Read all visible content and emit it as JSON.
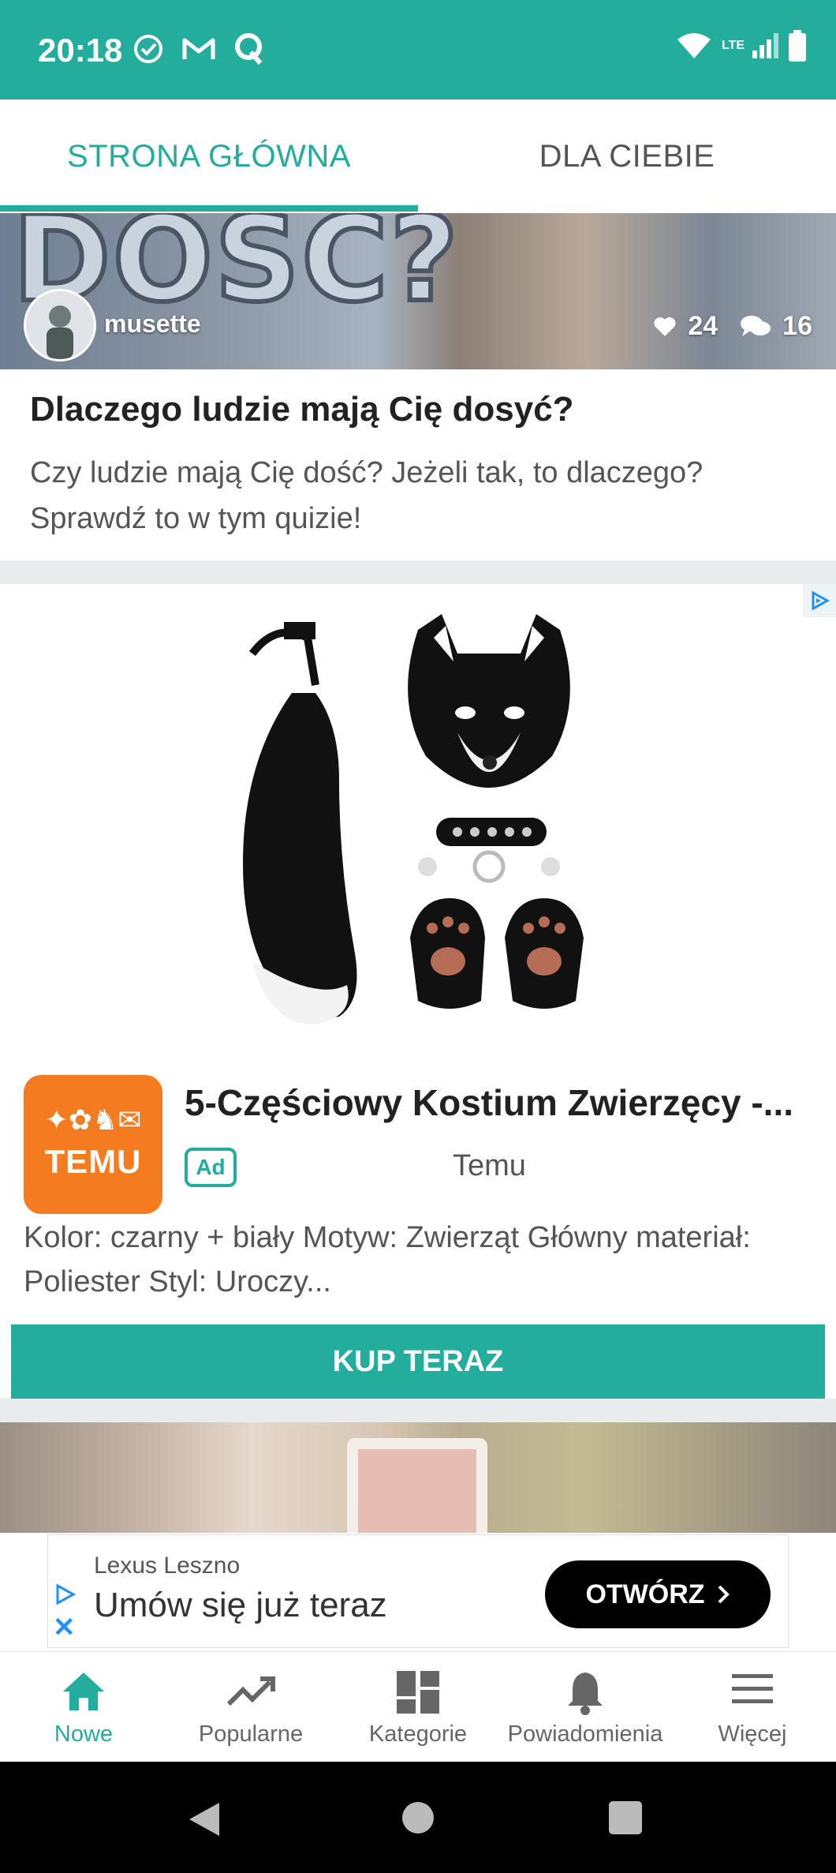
{
  "status_bar": {
    "time": "20:18",
    "network": "LTE"
  },
  "tabs": [
    {
      "label": "STRONA GŁÓWNA",
      "active": true
    },
    {
      "label": "DLA CIEBIE",
      "active": false
    }
  ],
  "featured_post": {
    "image_text": "DOŚĆ?",
    "author": "musette",
    "likes": "24",
    "comments": "16",
    "title": "Dlaczego ludzie mają Cię dosyć?",
    "description": "Czy ludzie mają Cię dość? Jeżeli tak, to dlaczego? Sprawdź to w tym quizie!"
  },
  "ad": {
    "title": "5-Częściowy Kostium Zwierzęcy -...",
    "badge": "Ad",
    "advertiser": "Temu",
    "logo_text": "TEMU",
    "description": "Kolor: czarny + biały Motyw: Zwierząt Główny materiał: Poliester Styl: Uroczy...",
    "cta": "KUP TERAZ"
  },
  "banner_ad": {
    "sponsor": "Lexus Leszno",
    "headline": "Umów się już teraz",
    "button": "OTWÓRZ"
  },
  "bottom_nav": [
    {
      "label": "Nowe",
      "icon": "home-icon",
      "active": true
    },
    {
      "label": "Popularne",
      "icon": "trending-icon",
      "active": false
    },
    {
      "label": "Kategorie",
      "icon": "dashboard-icon",
      "active": false
    },
    {
      "label": "Powiadomienia",
      "icon": "bell-icon",
      "active": false
    },
    {
      "label": "Więcej",
      "icon": "menu-icon",
      "active": false
    }
  ],
  "colors": {
    "accent": "#22ad9c",
    "temu_orange": "#f47b20"
  }
}
